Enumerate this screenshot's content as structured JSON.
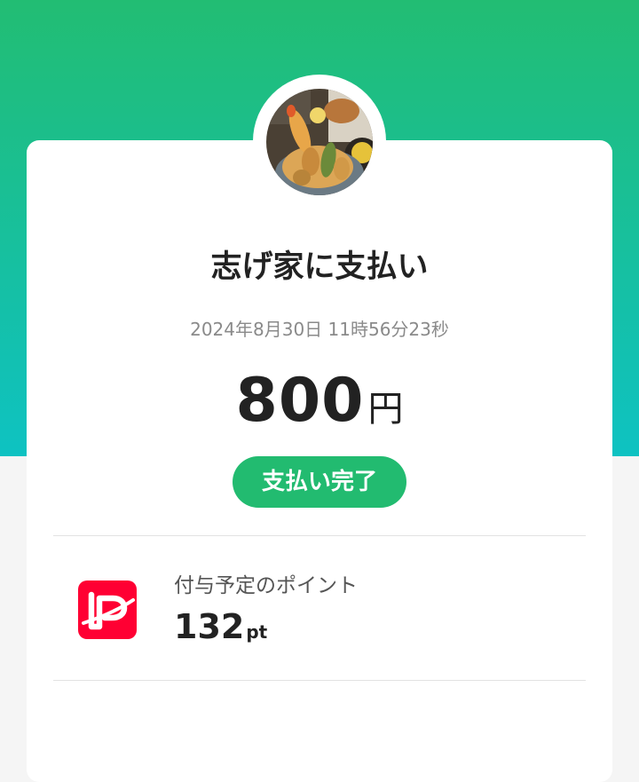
{
  "header": {
    "gradient_top": "#22bd73",
    "gradient_bottom": "#0ec2c2"
  },
  "store": {
    "avatar_icon": "tempura-food-photo"
  },
  "payment": {
    "title": "志げ家に支払い",
    "datetime": "2024年8月30日 11時56分23秒",
    "amount": "800",
    "currency_unit": "円",
    "status": "支払い完了",
    "status_color": "#22bb70"
  },
  "points": {
    "label": "付与予定のポイント",
    "value": "132",
    "unit": "pt",
    "logo_icon": "paypay-logo-icon",
    "logo_color": "#ff0033"
  }
}
